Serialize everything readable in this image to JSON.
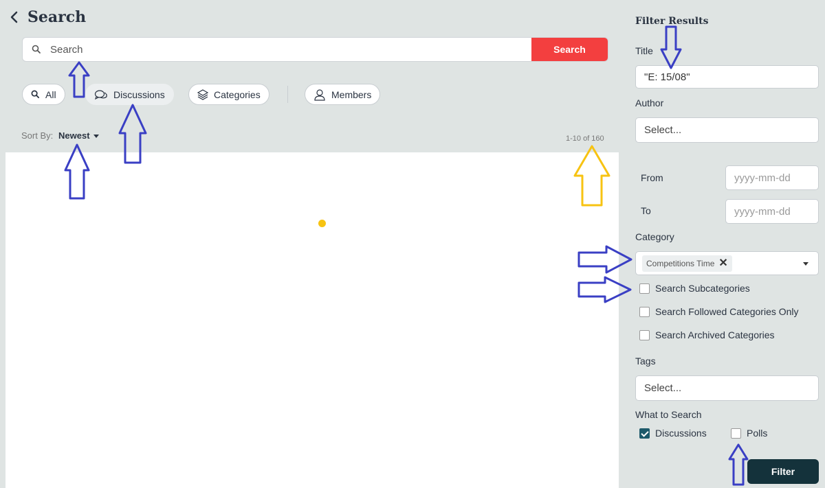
{
  "header": {
    "title": "Search"
  },
  "search": {
    "placeholder": "Search",
    "button_label": "Search"
  },
  "tabs": [
    {
      "label": "All",
      "icon": "search-icon"
    },
    {
      "label": "Discussions",
      "icon": "discussions-icon",
      "active": true
    },
    {
      "label": "Categories",
      "icon": "layers-icon"
    },
    {
      "label": "Members",
      "icon": "person-icon"
    }
  ],
  "sort": {
    "label": "Sort By:",
    "value": "Newest"
  },
  "results": {
    "count_text": "1-10 of 160"
  },
  "filters": {
    "title": "Filter Results",
    "title_label": "Title",
    "title_value": "\"E: 15/08\"",
    "author_label": "Author",
    "author_placeholder": "Select...",
    "from_label": "From",
    "to_label": "To",
    "date_placeholder": "yyyy-mm-dd",
    "category_label": "Category",
    "category_token": "Competitions Time",
    "category_token_remove": "✕",
    "checkboxes": [
      {
        "label": "Search Subcategories",
        "checked": false
      },
      {
        "label": "Search Followed Categories Only",
        "checked": false
      },
      {
        "label": "Search Archived Categories",
        "checked": false
      }
    ],
    "tags_label": "Tags",
    "tags_placeholder": "Select...",
    "what_label": "What to Search",
    "what_options": [
      {
        "label": "Discussions",
        "checked": true
      },
      {
        "label": "Polls",
        "checked": false
      }
    ],
    "filter_button": "Filter"
  },
  "colors": {
    "accent": "#f33f3f",
    "primary": "#14323b",
    "checkbox": "#1e5a6b",
    "annotation_blue": "#3a3fc4",
    "annotation_yellow": "#f7c312"
  }
}
